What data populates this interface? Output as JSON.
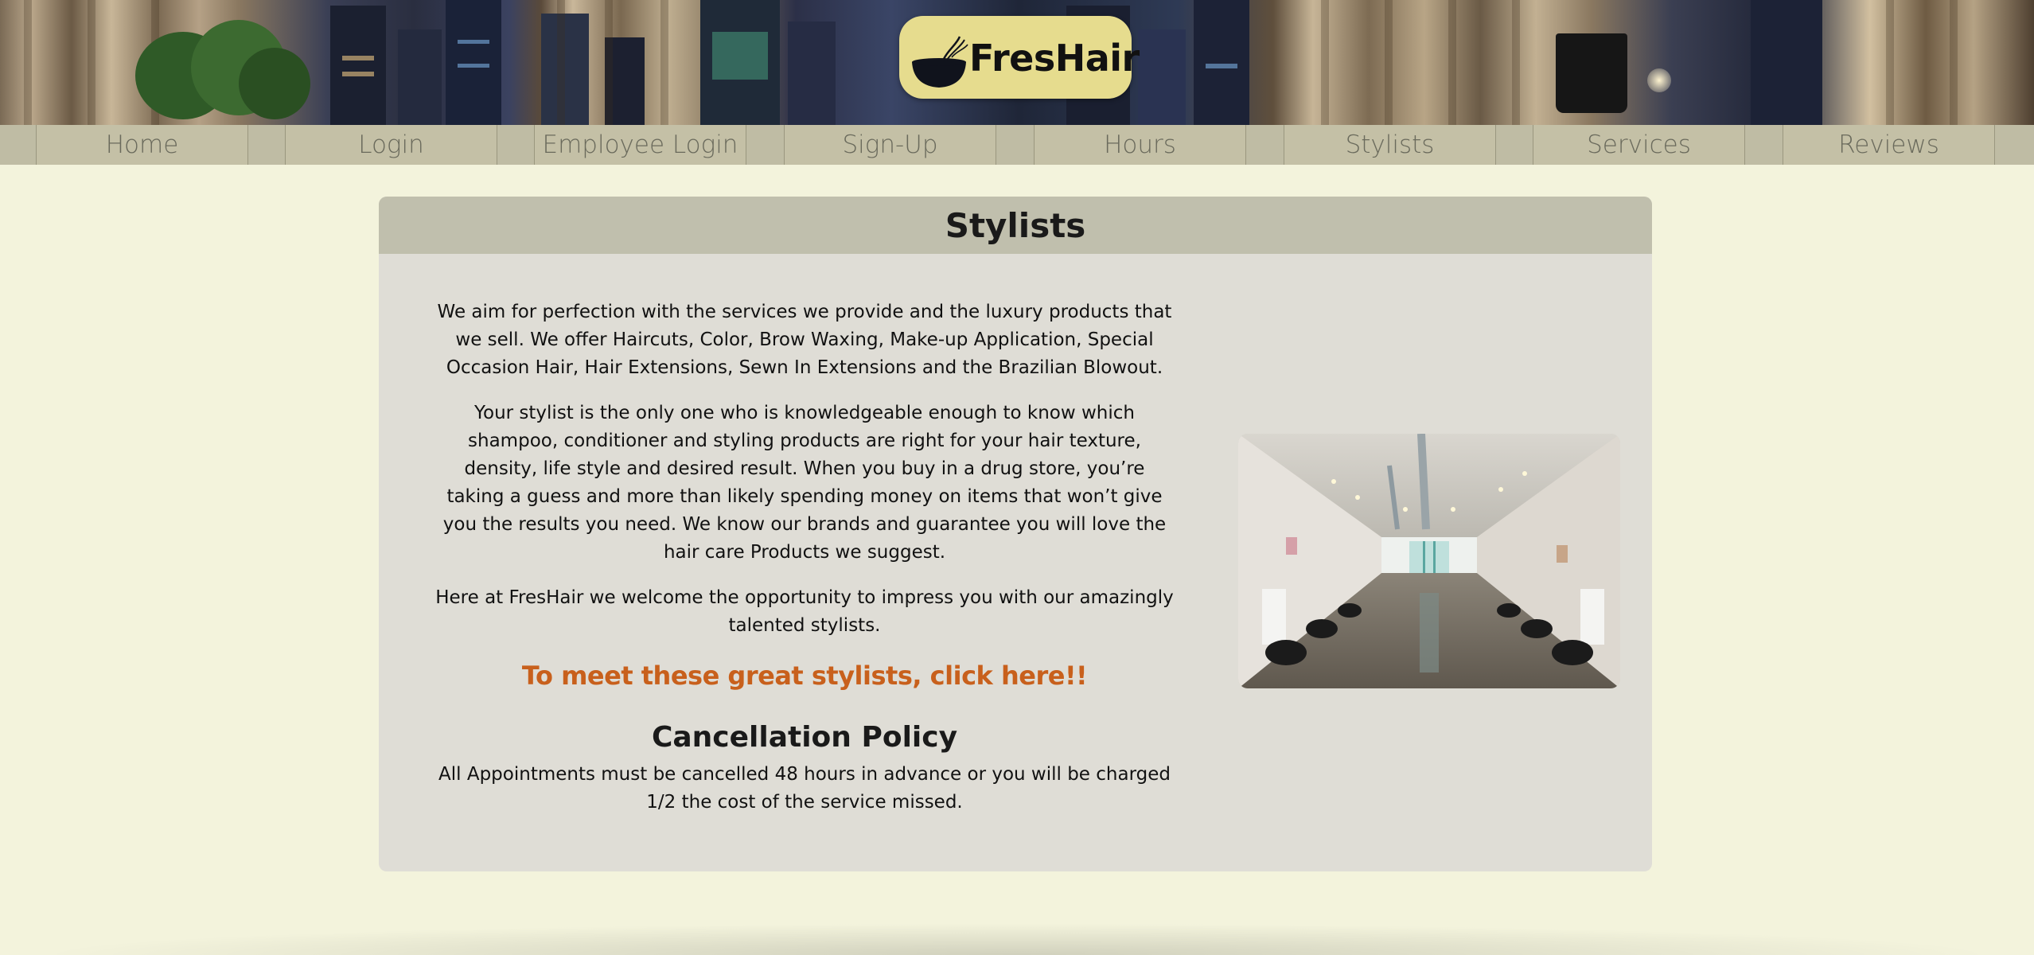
{
  "brand": {
    "name": "FresHair",
    "logo_icon": "hair-bowl-icon"
  },
  "nav": {
    "items": [
      {
        "label": "Home"
      },
      {
        "label": "Login"
      },
      {
        "label": "Employee Login"
      },
      {
        "label": "Sign-Up"
      },
      {
        "label": "Hours"
      },
      {
        "label": "Stylists"
      },
      {
        "label": "Services"
      },
      {
        "label": "Reviews"
      }
    ]
  },
  "page": {
    "title": "Stylists",
    "paragraphs": [
      "We aim for perfection with the services we provide and the luxury products that we sell. We offer Haircuts, Color, Brow Waxing, Make-up Application, Special Occasion Hair, Hair Extensions, Sewn In Extensions and the Brazilian Blowout.",
      "Your stylist is the only one who is knowledgeable enough to know which shampoo, conditioner and styling products are right for your hair texture, density, life style and desired result. When you buy in a drug store, you’re taking a guess and more than likely spending money on items that won’t give you the results you need. We know our brands and guarantee you will love the hair care Products we suggest.",
      "Here at FresHair we welcome the opportunity to impress you with our amazingly talented stylists."
    ],
    "cta_label": "To meet these great stylists, click here!!",
    "policy_title": "Cancellation Policy",
    "policy_text": "All Appointments must be cancelled 48 hours in advance or you will be charged 1/2 the cost of the service missed."
  },
  "colors": {
    "background": "#f3f3dc",
    "nav": "#c4c0a6",
    "card": "#dfddd6",
    "card_header": "#c0bfad",
    "logo_badge": "#e6dc8e",
    "cta": "#c8601c"
  }
}
